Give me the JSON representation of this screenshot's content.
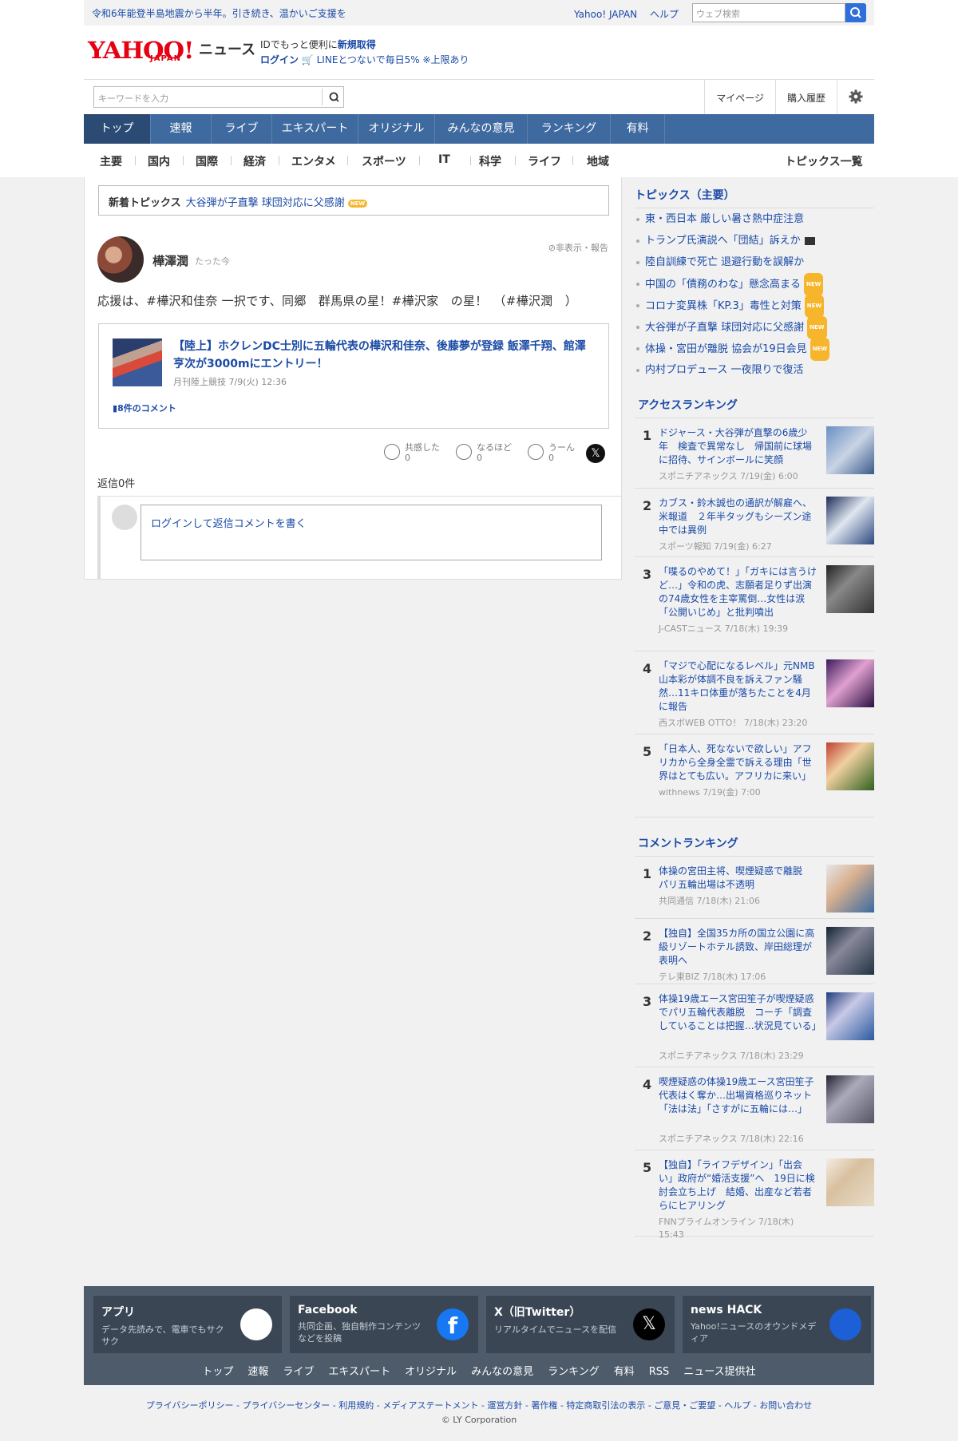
{
  "topbar": {
    "notice": "令和6年能登半島地震から半年。引き続き、温かいご支援を",
    "yahoo_japan": "Yahoo! JAPAN",
    "help": "ヘルプ",
    "web_search_placeholder": "ウェブ検索"
  },
  "header": {
    "logo": "YAHOO!",
    "logo_sub": "JAPAN",
    "news": "ニュース",
    "id_line1_pre": "IDでもっと便利に",
    "id_line1_link": "新規取得",
    "login": "ログイン",
    "line_promo": "LINEとつないで毎日5% ※上限あり"
  },
  "search": {
    "placeholder": "キーワードを入力",
    "mypage": "マイページ",
    "history": "購入履歴"
  },
  "mainnav": [
    "トップ",
    "速報",
    "ライブ",
    "エキスパート",
    "オリジナル",
    "みんなの意見",
    "ランキング",
    "有料"
  ],
  "subnav": [
    "主要",
    "国内",
    "国際",
    "経済",
    "エンタメ",
    "スポーツ",
    "IT",
    "科学",
    "ライフ",
    "地域"
  ],
  "subnav_all": "トピックス一覧",
  "newtopic": {
    "label": "新着トピックス",
    "title": "大谷弾が子直撃 球団対応に父感謝",
    "badge": "NEW"
  },
  "post": {
    "user": "樺澤潤",
    "time": "たった今",
    "hide_report": "非表示・報告",
    "text": "応援は、#樺沢和佳奈 一択です、同郷　群馬県の星！#樺沢家　の星！　（#樺沢潤　）"
  },
  "card": {
    "title": "【陸上】ホクレンDC士別に五輪代表の樺沢和佳奈、後藤夢が登録 飯澤千翔、館澤亨次が3000mにエントリー！",
    "meta": "月刊陸上競技 7/9(火) 12:36",
    "comments": "8件のコメント"
  },
  "reactions": [
    {
      "label": "共感した",
      "count": "0"
    },
    {
      "label": "なるほど",
      "count": "0"
    },
    {
      "label": "うーん",
      "count": "0"
    }
  ],
  "replies": {
    "label": "返信0件",
    "placeholder": "ログインして返信コメントを書く"
  },
  "topics": {
    "heading": "トピックス（主要）",
    "items": [
      {
        "text": "東・西日本 厳しい暑さ熱中症注意"
      },
      {
        "text": "トランプ氏演説へ「団結」訴えか"
      },
      {
        "text": "陸自訓練で死亡 退避行動を誤解か"
      },
      {
        "text": "中国の「債務のわな」懸念高まる",
        "badge": "NEW"
      },
      {
        "text": "コロナ変異株「KP.3」毒性と対策",
        "badge": "NEW"
      },
      {
        "text": "大谷弾が子直撃 球団対応に父感謝",
        "badge": "NEW"
      },
      {
        "text": "体操・宮田が離脱 協会が19日会見",
        "badge": "NEW"
      },
      {
        "text": "内村プロデュース 一夜限りで復活"
      }
    ]
  },
  "access_ranking": {
    "heading": "アクセスランキング",
    "items": [
      {
        "num": "1",
        "title": "ドジャース・大谷弾が直撃の6歳少年　検査で異常なし　帰国前に球場に招待、サインボールに笑顔",
        "source": "スポニチアネックス 7/19(金) 6:00"
      },
      {
        "num": "2",
        "title": "カブス・鈴木誠也の通訳が解雇へ、米報道　２年半タッグもシーズン途中では異例",
        "source": "スポーツ報知 7/19(金) 6:27"
      },
      {
        "num": "3",
        "title": "「喋るのやめて！」「ガキには言うけど…」令和の虎、志願者足りず出演の74歳女性を主宰罵倒…女性は涙　「公開いじめ」と批判噴出",
        "source": "J-CASTニュース 7/18(木) 19:39"
      },
      {
        "num": "4",
        "title": "「マジで心配になるレベル」元NMB山本彩が体調不良を訴えファン騒然…11キロ体重が落ちたことを4月に報告",
        "source": "西スポWEB OTTO！ 7/18(木) 23:20"
      },
      {
        "num": "5",
        "title": "「日本人、死なないで欲しい」アフリカから全身全霊で訴える理由「世界はとても広い。アフリカに来い」",
        "source": "withnews 7/19(金) 7:00"
      }
    ]
  },
  "comment_ranking": {
    "heading": "コメントランキング",
    "items": [
      {
        "num": "1",
        "title": "体操の宮田主将、喫煙疑惑で離脱　パリ五輪出場は不透明",
        "source": "共同通信 7/18(木) 21:06"
      },
      {
        "num": "2",
        "title": "【独自】全国35カ所の国立公園に高級リゾートホテル誘致、岸田総理が表明へ",
        "source": "テレ東BIZ 7/18(木) 17:06"
      },
      {
        "num": "3",
        "title": "体操19歳エース宮田笙子が喫煙疑惑でパリ五輪代表離脱　コーチ「調査していることは把握…状況見ている」",
        "source": "スポニチアネックス 7/18(木) 23:29"
      },
      {
        "num": "4",
        "title": "喫煙疑惑の体操19歳エース宮田笙子　代表はく奪か…出場資格巡りネット「法は法」「さすがに五輪には…」",
        "source": "スポニチアネックス 7/18(木) 22:16"
      },
      {
        "num": "5",
        "title": "【独自】「ライフデザイン」「出会い」政府が“婚活支援”へ　19日に検討会立ち上げ　結婚、出産など若者らにヒアリング",
        "source": "FNNプライムオンライン 7/18(木) 15:43"
      }
    ]
  },
  "footer": {
    "boxes": [
      {
        "title": "アプリ",
        "desc": "データ先読みで、電車でもサクサク"
      },
      {
        "title": "Facebook",
        "desc": "共同企画、独自制作コンテンツなどを投稿"
      },
      {
        "title": "X（旧Twitter）",
        "desc": "リアルタイムでニュースを配信"
      },
      {
        "title": "news HACK",
        "desc": "Yahoo!ニュースのオウンドメディア"
      }
    ],
    "links": [
      "トップ",
      "速報",
      "ライブ",
      "エキスパート",
      "オリジナル",
      "みんなの意見",
      "ランキング",
      "有料",
      "RSS",
      "ニュース提供社"
    ],
    "legal": "プライバシーポリシー - プライバシーセンター - 利用規約 - メディアステートメント - 運営方針 - 著作権 - 特定商取引法の表示 - ご意見・ご要望 - ヘルプ - お問い合わせ",
    "copyright": "© LY Corporation"
  },
  "colors": {
    "accent": "#1a4aa6",
    "nav": "#3f6aa0",
    "brand": "#e60012",
    "badge": "#f7b52c"
  }
}
